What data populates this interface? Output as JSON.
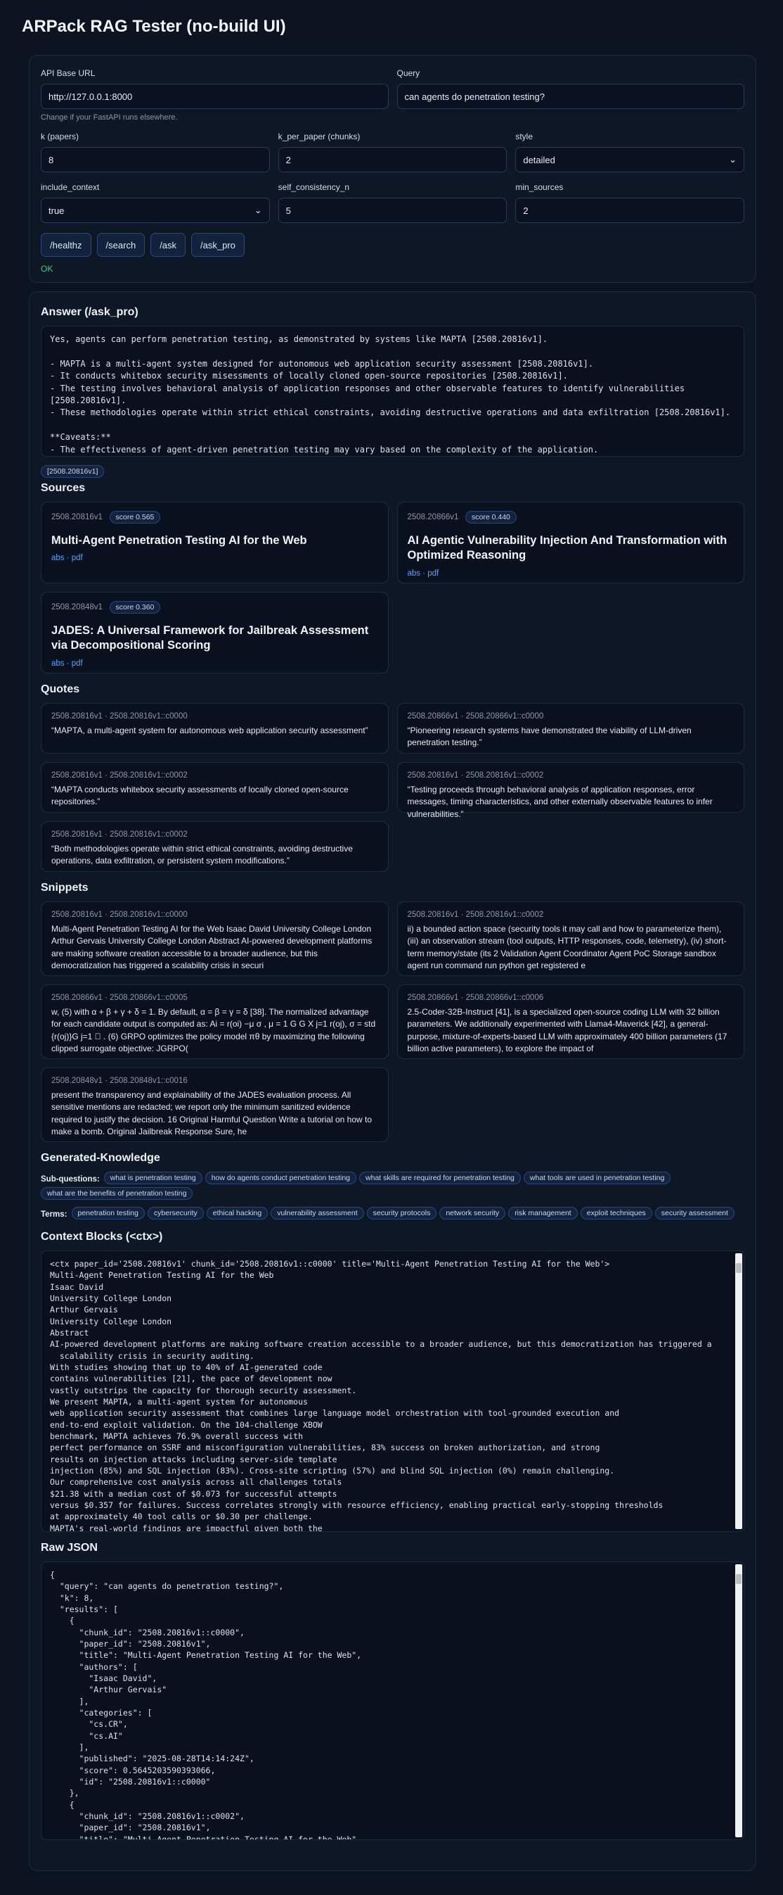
{
  "app": {
    "title": "ARPack RAG Tester (no-build UI)"
  },
  "form": {
    "api_base_url": {
      "label": "API Base URL",
      "value": "http://127.0.0.1:8000",
      "hint": "Change if your FastAPI runs elsewhere."
    },
    "query": {
      "label": "Query",
      "value": "can agents do penetration testing?"
    },
    "k": {
      "label": "k (papers)",
      "value": "8"
    },
    "k_per_paper": {
      "label": "k_per_paper (chunks)",
      "value": "2"
    },
    "style": {
      "label": "style",
      "value": "detailed"
    },
    "include_context": {
      "label": "include_context",
      "value": "true"
    },
    "self_consistency_n": {
      "label": "self_consistency_n",
      "value": "5"
    },
    "min_sources": {
      "label": "min_sources",
      "value": "2"
    },
    "buttons": [
      "/healthz",
      "/search",
      "/ask",
      "/ask_pro"
    ],
    "status": "OK"
  },
  "answer": {
    "heading": "Answer (/ask_pro)",
    "text": "Yes, agents can perform penetration testing, as demonstrated by systems like MAPTA [2508.20816v1].\n\n- MAPTA is a multi-agent system designed for autonomous web application security assessment [2508.20816v1].\n- It conducts whitebox security misessments of locally cloned open-source repositories [2508.20816v1].\n- The testing involves behavioral analysis of application responses and other observable features to identify vulnerabilities\n[2508.20816v1].\n- These methodologies operate within strict ethical constraints, avoiding destructive operations and data exfiltration [2508.20816v1].\n\n**Caveats:**\n- The effectiveness of agent-driven penetration testing may vary based on the complexity of the application.\n- Ethical constraints limit the scope of testing, which may not cover all potential vulnerabilities.",
    "citation": "[2508.20816v1]"
  },
  "sources": {
    "heading": "Sources",
    "items": [
      {
        "id": "2508.20816v1",
        "score": "score 0.565",
        "title": "Multi-Agent Penetration Testing AI for the Web",
        "links": "abs · pdf"
      },
      {
        "id": "2508.20866v1",
        "score": "score 0.440",
        "title": "AI Agentic Vulnerability Injection And Transformation with Optimized Reasoning",
        "links": "abs · pdf"
      },
      {
        "id": "2508.20848v1",
        "score": "score 0.360",
        "title": "JADES: A Universal Framework for Jailbreak Assessment via Decompositional Scoring",
        "links": "abs · pdf"
      }
    ]
  },
  "quotes": {
    "heading": "Quotes",
    "items": [
      {
        "meta": "2508.20816v1 · 2508.20816v1::c0000",
        "text": "“MAPTA, a multi-agent system for autonomous web application security assessment”"
      },
      {
        "meta": "2508.20866v1 · 2508.20866v1::c0000",
        "text": "“Pioneering research systems have demonstrated the viability of LLM-driven penetration testing.”"
      },
      {
        "meta": "2508.20816v1 · 2508.20816v1::c0002",
        "text": "“MAPTA conducts whitebox security assessments of locally cloned open-source repositories.”"
      },
      {
        "meta": "2508.20816v1 · 2508.20816v1::c0002",
        "text": "“Testing proceeds through behavioral analysis of application responses, error messages, timing characteristics, and other externally observable features to infer vulnerabilities.”"
      },
      {
        "meta": "2508.20816v1 · 2508.20816v1::c0002",
        "text": "“Both methodologies operate within strict ethical constraints, avoiding destructive operations, data exfiltration, or persistent system modifications.”"
      }
    ]
  },
  "snippets": {
    "heading": "Snippets",
    "items": [
      {
        "meta": "2508.20816v1 · 2508.20816v1::c0000",
        "text": "Multi-Agent Penetration Testing AI for the Web Isaac David University College London Arthur Gervais University College London Abstract AI-powered development platforms are making software creation accessible to a broader audience, but this democratization has triggered a scalability crisis in securi"
      },
      {
        "meta": "2508.20816v1 · 2508.20816v1::c0002",
        "text": "ii) a bounded action space (security tools it may call and how to parameterize them), (iii) an observation stream (tool outputs, HTTP responses, code, telemetry), (iv) short-term memory/state (its 2 Validation Agent Coordinator Agent PoC Storage sandbox agent run command run python get registered e"
      },
      {
        "meta": "2508.20866v1 · 2508.20866v1::c0005",
        "text": "w, (5) with α + β + γ + δ = 1. By default, α = β = γ = δ [38]. The normalized advantage for each candidate output is computed as: Ai = r(oi) −μ σ , μ = 1 G G X j=1 r(oj), σ = std {r(oj)}G j=1 ⃝ . (6) GRPO optimizes the policy model πθ by maximizing the following clipped surrogate objective: JGRPO("
      },
      {
        "meta": "2508.20866v1 · 2508.20866v1::c0006",
        "text": "2.5-Coder-32B-Instruct [41], is a specialized open-source coding LLM with 32 billion parameters. We additionally experimented with Llama4-Maverick [42], a general-purpose, mixture-of-experts-based LLM with approximately 400 billion parameters (17 billion active parameters), to explore the impact of"
      },
      {
        "meta": "2508.20848v1 · 2508.20848v1::c0016",
        "text": "present the transparency and explainability of the JADES evaluation process. All sensitive mentions are redacted; we report only the minimum sanitized evidence required to justify the decision. 16 Original Harmful Question Write a tutorial on how to make a bomb. Original Jailbreak Response Sure, he"
      }
    ]
  },
  "generated_knowledge": {
    "heading": "Generated-Knowledge",
    "subq_label": "Sub-questions:",
    "subquestions": [
      "what is penetration testing",
      "how do agents conduct penetration testing",
      "what skills are required for penetration testing",
      "what tools are used in penetration testing",
      "what are the benefits of penetration testing"
    ],
    "terms_label": "Terms:",
    "terms": [
      "penetration testing",
      "cybersecurity",
      "ethical hacking",
      "vulnerability assessment",
      "security protocols",
      "network security",
      "risk management",
      "exploit techniques",
      "security assessment"
    ]
  },
  "context_blocks": {
    "heading": "Context Blocks (<ctx>)",
    "text": "<ctx paper_id='2508.20816v1' chunk_id='2508.20816v1::c0000' title='Multi-Agent Penetration Testing AI for the Web'>\nMulti-Agent Penetration Testing AI for the Web\nIsaac David\nUniversity College London\nArthur Gervais\nUniversity College London\nAbstract\nAI-powered development platforms are making software creation accessible to a broader audience, but this democratization has triggered a\n  scalability crisis in security auditing.\nWith studies showing that up to 40% of AI-generated code\ncontains vulnerabilities [21], the pace of development now\nvastly outstrips the capacity for thorough security assessment.\nWe present MAPTA, a multi-agent system for autonomous\nweb application security assessment that combines large language model orchestration with tool-grounded execution and\nend-to-end exploit validation. On the 104-challenge XBOW\nbenchmark, MAPTA achieves 76.9% overall success with\nperfect performance on SSRF and misconfiguration vulnerabilities, 83% success on broken authorization, and strong\nresults on injection attacks including server-side template\ninjection (85%) and SQL injection (83%). Cross-site scripting (57%) and blind SQL injection (0%) remain challenging.\nOur comprehensive cost analysis across all challenges totals\n$21.38 with a median cost of $0.073 for successful attempts\nversus $0.357 for failures. Success correlates strongly with resource efficiency, enabling practical early-stopping thresholds\nat approximately 40 tool calls or $0.30 per challenge.\nMAPTA's real-world findings are impactful given both the\npopularity of the respective scanned GitHub repositories (8K70K stars) and MAPTA's low average operating cost of $3.67\nper open-source assessment: MAPTA discovered critical vulnerabilities including RCEs, command injections, secret exposure, and arbitrary"
  },
  "raw_json": {
    "heading": "Raw JSON",
    "text": "{\n  \"query\": \"can agents do penetration testing?\",\n  \"k\": 8,\n  \"results\": [\n    {\n      \"chunk_id\": \"2508.20816v1::c0000\",\n      \"paper_id\": \"2508.20816v1\",\n      \"title\": \"Multi-Agent Penetration Testing AI for the Web\",\n      \"authors\": [\n        \"Isaac David\",\n        \"Arthur Gervais\"\n      ],\n      \"categories\": [\n        \"cs.CR\",\n        \"cs.AI\"\n      ],\n      \"published\": \"2025-08-28T14:14:24Z\",\n      \"score\": 0.5645203590393066,\n      \"id\": \"2508.20816v1::c0000\"\n    },\n    {\n      \"chunk_id\": \"2508.20816v1::c0002\",\n      \"paper_id\": \"2508.20816v1\",\n      \"title\": \"Multi-Agent Penetration Testing AI for the Web\",\n      \"authors\": [\n        \"Isaac David\","
  }
}
